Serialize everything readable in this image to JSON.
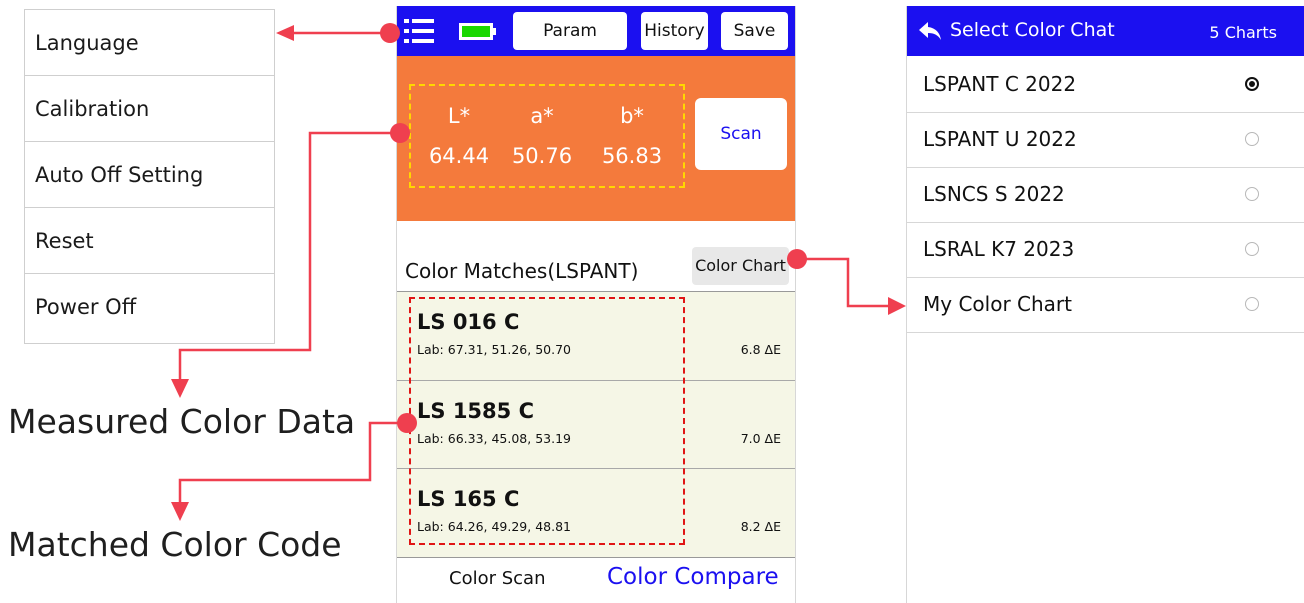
{
  "settings_menu": {
    "items": [
      {
        "label": "Language"
      },
      {
        "label": "Calibration"
      },
      {
        "label": "Auto Off Setting"
      },
      {
        "label": "Reset"
      },
      {
        "label": "Power Off"
      }
    ]
  },
  "callouts": {
    "measured": "Measured Color Data",
    "matched": "Matched Color Code"
  },
  "toolbar": {
    "param_label": "Param",
    "history_label": "History",
    "save_label": "Save"
  },
  "measurement": {
    "l_label": "L*",
    "a_label": "a*",
    "b_label": "b*",
    "l_value": "64.44",
    "a_value": "50.76",
    "b_value": "56.83",
    "scan_label": "Scan"
  },
  "matches": {
    "title": "Color Matches(LSPANT)",
    "chart_button": "Color Chart",
    "rows": [
      {
        "code": "LS 016 C",
        "lab": "Lab: 67.31, 51.26, 50.70",
        "delta": "6.8 ΔE"
      },
      {
        "code": "LS 1585 C",
        "lab": "Lab: 66.33, 45.08, 53.19",
        "delta": "7.0 ΔE"
      },
      {
        "code": "LS 165 C",
        "lab": "Lab: 64.26, 49.29, 48.81",
        "delta": "8.2 ΔE"
      }
    ]
  },
  "bottom_tabs": {
    "scan": "Color Scan",
    "compare": "Color Compare"
  },
  "chart_select": {
    "title": "Select Color Chat",
    "count": "5 Charts",
    "options": [
      {
        "label": "LSPANT C 2022",
        "selected": true
      },
      {
        "label": "LSPANT U 2022",
        "selected": false
      },
      {
        "label": "LSNCS S 2022",
        "selected": false
      },
      {
        "label": "LSRAL K7 2023",
        "selected": false
      },
      {
        "label": "My Color Chart",
        "selected": false
      }
    ]
  },
  "colors": {
    "accent_blue": "#1b10f0",
    "panel_orange": "#f47a3c",
    "callout_red": "#ef3f4f",
    "battery_green": "#19d700"
  }
}
